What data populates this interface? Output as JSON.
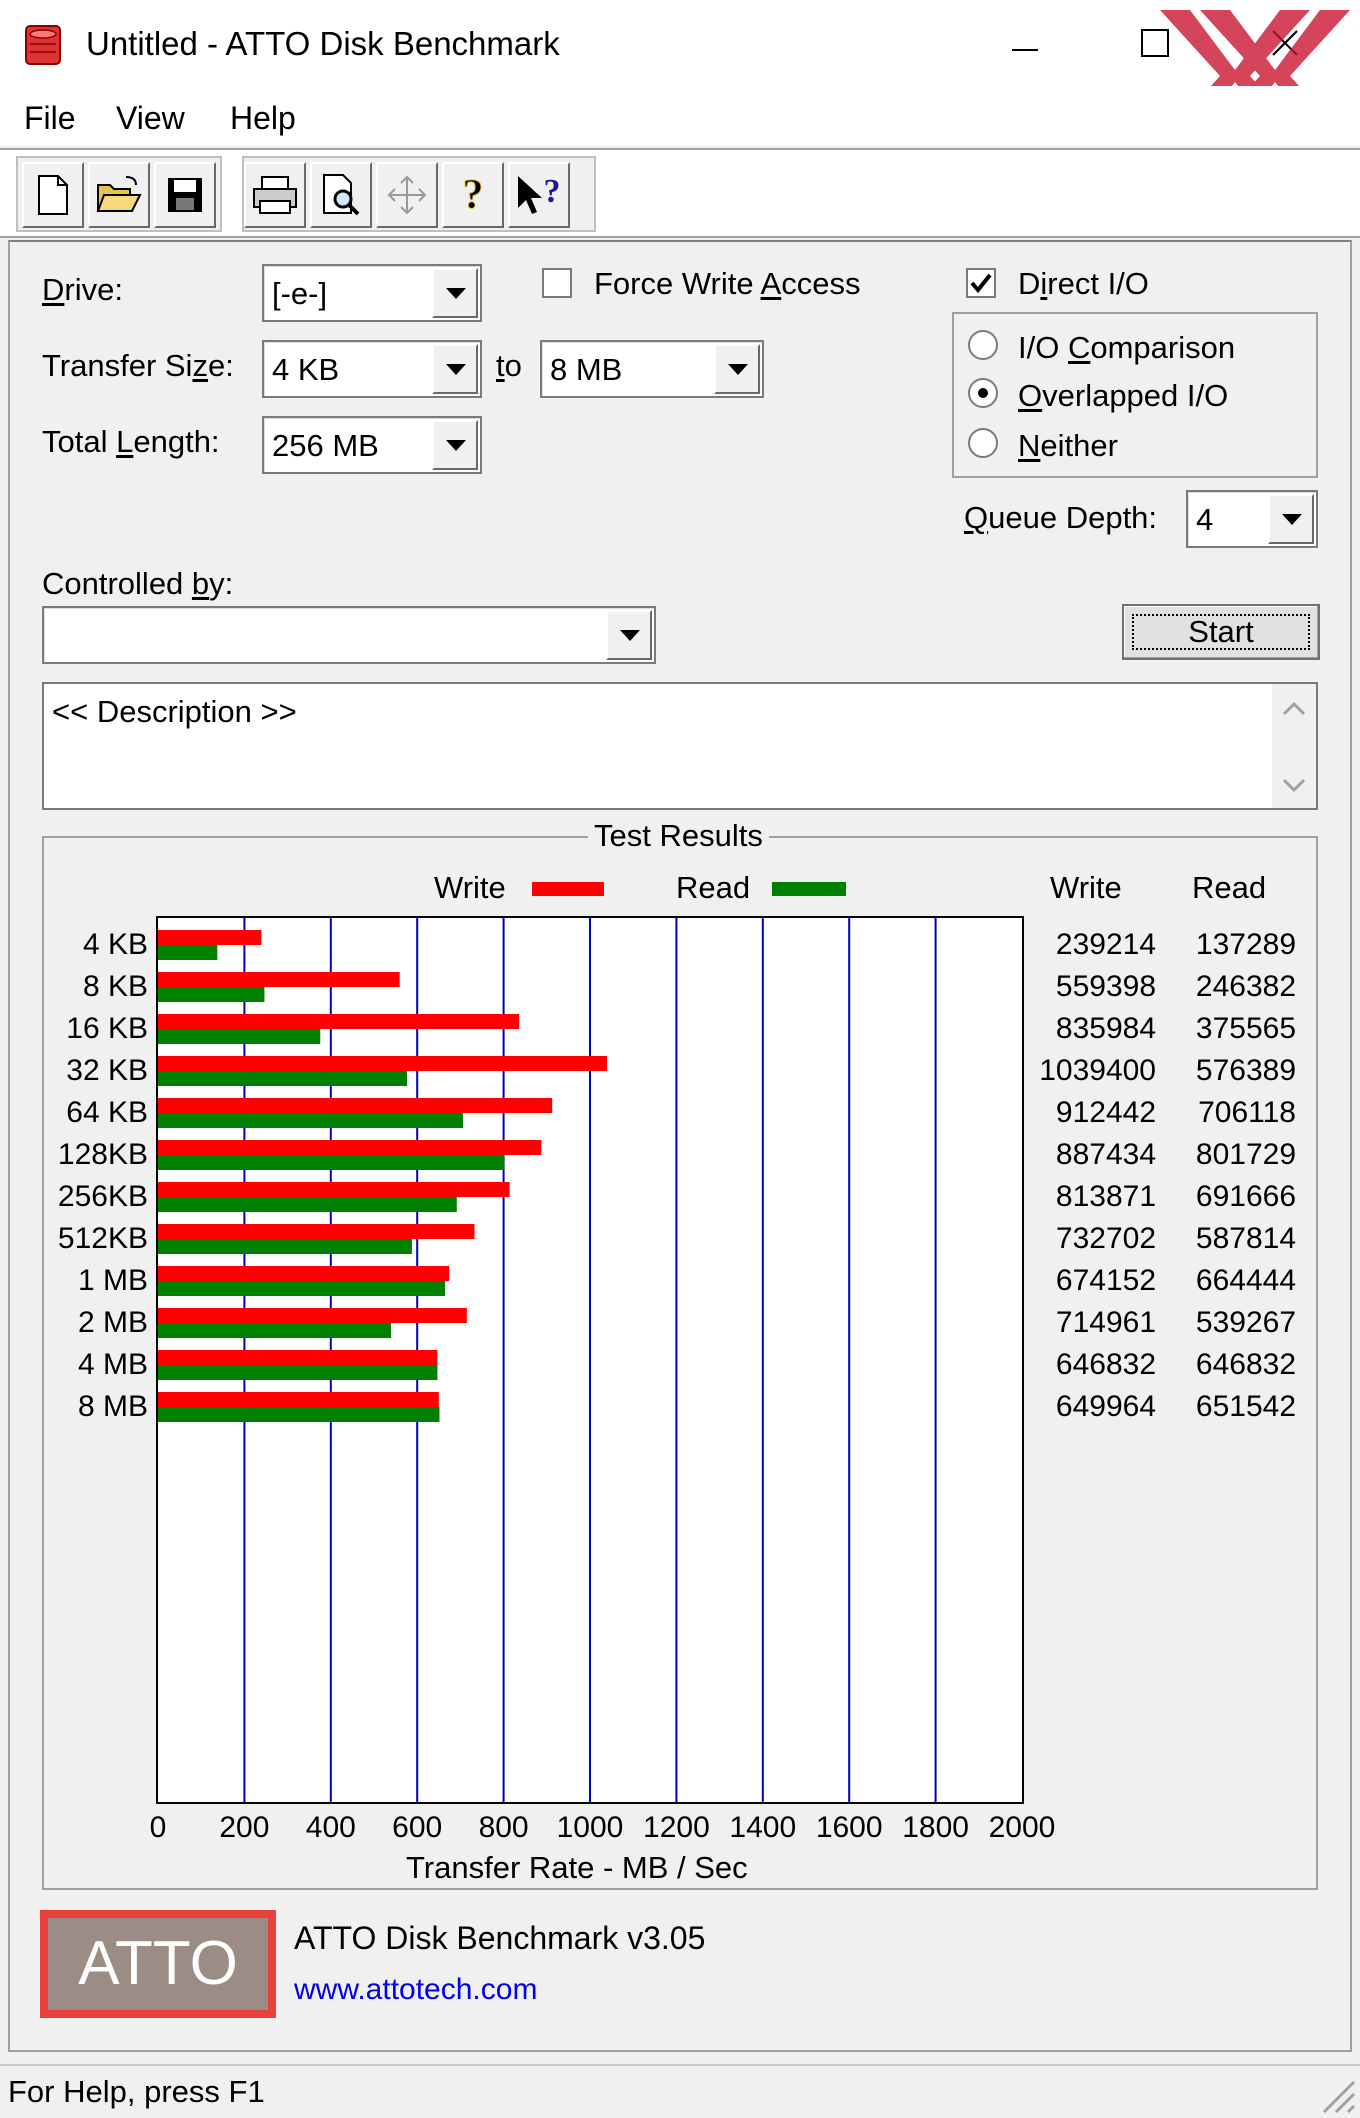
{
  "window": {
    "title": "Untitled - ATTO Disk Benchmark"
  },
  "menu": {
    "file": "File",
    "view": "View",
    "help": "Help"
  },
  "toolbar": {
    "buttons": [
      "new-icon",
      "open-icon",
      "save-icon",
      "print-icon",
      "print-preview-icon",
      "move-icon",
      "help-icon",
      "context-help-icon"
    ]
  },
  "form": {
    "drive_label": "Drive:",
    "drive_value": "[-e-]",
    "transfer_size_label": "Transfer Size:",
    "transfer_from": "4 KB",
    "to_label": "to",
    "transfer_to": "8 MB",
    "total_length_label": "Total Length:",
    "total_length_value": "256 MB",
    "force_write_label": "Force Write Access",
    "force_write_checked": false,
    "direct_io_label": "Direct I/O",
    "direct_io_checked": true,
    "io_comparison_label": "I/O Comparison",
    "overlapped_io_label": "Overlapped I/O",
    "neither_label": "Neither",
    "io_mode_selected": "Overlapped I/O",
    "queue_depth_label": "Queue Depth:",
    "queue_depth_value": "4",
    "controlled_by_label": "Controlled by:",
    "controlled_by_value": "",
    "start_label": "Start",
    "description": "<< Description >>"
  },
  "results": {
    "group_title": "Test Results",
    "col_write": "Write",
    "col_read": "Read"
  },
  "chart_data": {
    "type": "bar",
    "orientation": "horizontal",
    "categories": [
      "4 KB",
      "8 KB",
      "16 KB",
      "32 KB",
      "64 KB",
      "128KB",
      "256KB",
      "512KB",
      "1 MB",
      "2 MB",
      "4 MB",
      "8 MB"
    ],
    "series": [
      {
        "name": "Write",
        "color": "#ff0000",
        "values": [
          239214,
          559398,
          835984,
          1039400,
          912442,
          887434,
          813871,
          732702,
          674152,
          714961,
          646832,
          649964
        ]
      },
      {
        "name": "Read",
        "color": "#008000",
        "values": [
          137289,
          246382,
          375565,
          576389,
          706118,
          801729,
          691666,
          587814,
          664444,
          539267,
          646832,
          651542
        ]
      }
    ],
    "xlabel": "Transfer Rate - MB / Sec",
    "xlim": [
      0,
      2000
    ],
    "xticks": [
      "0",
      "200",
      "400",
      "600",
      "800",
      "1000",
      "1200",
      "1400",
      "1600",
      "1800",
      "2000"
    ],
    "grid": true,
    "grid_color": "#0000c0",
    "legend": "top"
  },
  "footer": {
    "logo_text": "ATTO",
    "version": "ATTO Disk Benchmark v3.05",
    "link": "www.attotech.com"
  },
  "status": {
    "text": "For Help, press F1"
  }
}
